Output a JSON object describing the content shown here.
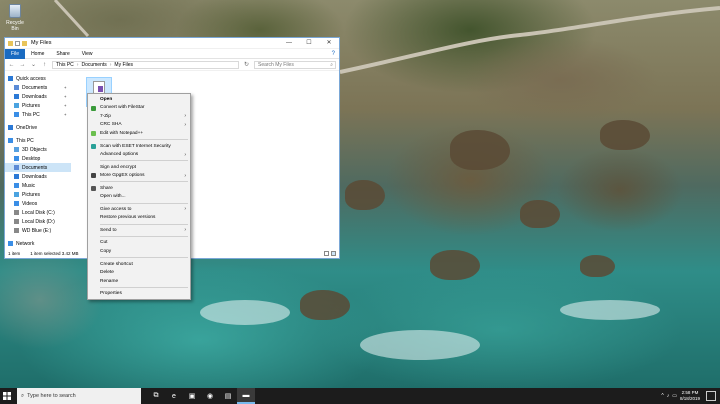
{
  "desktop": {
    "recycle_bin_label": "Recycle Bin"
  },
  "window": {
    "title": "My Files",
    "controls": {
      "minimize": "—",
      "maximize": "☐",
      "close": "✕"
    },
    "ribbon_tabs": [
      "File",
      "Home",
      "Share",
      "View"
    ],
    "help_glyph": "?",
    "address_path": [
      "This PC",
      "Documents",
      "My Files"
    ],
    "search_placeholder": "Search My Files",
    "nav_back": "←",
    "nav_forward": "→",
    "nav_up": "↑",
    "nav_recent": "⌄",
    "nav_refresh": "↻"
  },
  "navpane": {
    "items": [
      {
        "label": "Quick access",
        "icon": "star-icon",
        "color": "#2b79d6",
        "indent": 0,
        "pinned": false,
        "selected": false
      },
      {
        "label": "Documents",
        "icon": "folder-docs-icon",
        "color": "#5b8bd6",
        "indent": 1,
        "pinned": true,
        "selected": false
      },
      {
        "label": "Downloads",
        "icon": "download-icon",
        "color": "#2b79d6",
        "indent": 1,
        "pinned": true,
        "selected": false
      },
      {
        "label": "Pictures",
        "icon": "pictures-icon",
        "color": "#4aa3e0",
        "indent": 1,
        "pinned": true,
        "selected": false
      },
      {
        "label": "This PC",
        "icon": "pc-icon",
        "color": "#3a8ee6",
        "indent": 1,
        "pinned": true,
        "selected": false
      },
      {
        "label": "OneDrive",
        "icon": "cloud-icon",
        "color": "#2b79d6",
        "indent": 0,
        "pinned": false,
        "selected": false
      },
      {
        "label": "This PC",
        "icon": "pc-icon",
        "color": "#3a8ee6",
        "indent": 0,
        "pinned": false,
        "selected": false
      },
      {
        "label": "3D Objects",
        "icon": "cube-icon",
        "color": "#56a0e0",
        "indent": 1,
        "pinned": false,
        "selected": false
      },
      {
        "label": "Desktop",
        "icon": "desktop-icon",
        "color": "#3a8ee6",
        "indent": 1,
        "pinned": false,
        "selected": false
      },
      {
        "label": "Documents",
        "icon": "folder-docs-icon",
        "color": "#5b8bd6",
        "indent": 1,
        "pinned": false,
        "selected": true
      },
      {
        "label": "Downloads",
        "icon": "download-icon",
        "color": "#2b79d6",
        "indent": 1,
        "pinned": false,
        "selected": false
      },
      {
        "label": "Music",
        "icon": "music-icon",
        "color": "#3a8ee6",
        "indent": 1,
        "pinned": false,
        "selected": false
      },
      {
        "label": "Pictures",
        "icon": "pictures-icon",
        "color": "#4aa3e0",
        "indent": 1,
        "pinned": false,
        "selected": false
      },
      {
        "label": "Videos",
        "icon": "video-icon",
        "color": "#3a8ee6",
        "indent": 1,
        "pinned": false,
        "selected": false
      },
      {
        "label": "Local Disk (C:)",
        "icon": "drive-icon",
        "color": "#888888",
        "indent": 1,
        "pinned": false,
        "selected": false
      },
      {
        "label": "Local Disk (D:)",
        "icon": "drive-icon",
        "color": "#888888",
        "indent": 1,
        "pinned": false,
        "selected": false
      },
      {
        "label": "WD Blue (E:)",
        "icon": "drive-icon",
        "color": "#888888",
        "indent": 1,
        "pinned": false,
        "selected": false
      },
      {
        "label": "Network",
        "icon": "network-icon",
        "color": "#3a8ee6",
        "indent": 0,
        "pinned": false,
        "selected": false
      }
    ]
  },
  "content": {
    "file_name": "..."
  },
  "statusbar": {
    "item_count": "1 item",
    "selection": "1 item selected  3.42 MB"
  },
  "context_menu": {
    "items": [
      {
        "type": "item",
        "label": "Open",
        "bold": true,
        "icon": null,
        "arrow": false
      },
      {
        "type": "item",
        "label": "Convert with FileStar",
        "bold": false,
        "icon": "filestar-icon",
        "icon_color": "#3a9a3a",
        "arrow": false
      },
      {
        "type": "item",
        "label": "7-Zip",
        "bold": false,
        "icon": null,
        "arrow": true
      },
      {
        "type": "item",
        "label": "CRC SHA",
        "bold": false,
        "icon": null,
        "arrow": true
      },
      {
        "type": "item",
        "label": "Edit with Notepad++",
        "bold": false,
        "icon": "notepadpp-icon",
        "icon_color": "#6bbf4e",
        "arrow": false
      },
      {
        "type": "sep"
      },
      {
        "type": "item",
        "label": "Scan with ESET Internet Security",
        "bold": false,
        "icon": "eset-icon",
        "icon_color": "#2aa198",
        "arrow": false
      },
      {
        "type": "item",
        "label": "Advanced options",
        "bold": false,
        "icon": null,
        "arrow": true
      },
      {
        "type": "sep"
      },
      {
        "type": "item",
        "label": "Sign and encrypt",
        "bold": false,
        "icon": null,
        "arrow": false
      },
      {
        "type": "item",
        "label": "More GpgEX options",
        "bold": false,
        "icon": "gpg-icon",
        "icon_color": "#444444",
        "arrow": true
      },
      {
        "type": "sep"
      },
      {
        "type": "item",
        "label": "Share",
        "bold": false,
        "icon": "share-icon",
        "icon_color": "#555555",
        "arrow": false
      },
      {
        "type": "item",
        "label": "Open with...",
        "bold": false,
        "icon": null,
        "arrow": false
      },
      {
        "type": "sep"
      },
      {
        "type": "item",
        "label": "Give access to",
        "bold": false,
        "icon": null,
        "arrow": true
      },
      {
        "type": "item",
        "label": "Restore previous versions",
        "bold": false,
        "icon": null,
        "arrow": false
      },
      {
        "type": "sep"
      },
      {
        "type": "item",
        "label": "Send to",
        "bold": false,
        "icon": null,
        "arrow": true
      },
      {
        "type": "sep"
      },
      {
        "type": "item",
        "label": "Cut",
        "bold": false,
        "icon": null,
        "arrow": false
      },
      {
        "type": "item",
        "label": "Copy",
        "bold": false,
        "icon": null,
        "arrow": false
      },
      {
        "type": "sep"
      },
      {
        "type": "item",
        "label": "Create shortcut",
        "bold": false,
        "icon": null,
        "arrow": false
      },
      {
        "type": "item",
        "label": "Delete",
        "bold": false,
        "icon": null,
        "arrow": false
      },
      {
        "type": "item",
        "label": "Rename",
        "bold": false,
        "icon": null,
        "arrow": false
      },
      {
        "type": "sep"
      },
      {
        "type": "item",
        "label": "Properties",
        "bold": false,
        "icon": null,
        "arrow": false
      }
    ]
  },
  "taskbar": {
    "search_placeholder": "Type here to search",
    "apps": [
      {
        "name": "task-view-icon",
        "glyph": "⧉",
        "active": false
      },
      {
        "name": "edge-icon",
        "glyph": "e",
        "active": false
      },
      {
        "name": "store-icon",
        "glyph": "▣",
        "active": false
      },
      {
        "name": "chrome-icon",
        "glyph": "◉",
        "active": false
      },
      {
        "name": "photos-icon",
        "glyph": "▤",
        "active": false
      },
      {
        "name": "file-explorer-icon",
        "glyph": "▬",
        "active": true
      }
    ],
    "tray_glyphs": [
      "^",
      "♪",
      "▭"
    ],
    "time": "2:58 PM",
    "date": "8/18/2019"
  },
  "colors": {
    "accent": "#1a6bc1",
    "selection": "#cce8ff",
    "taskbar": "#1c1c1c"
  }
}
